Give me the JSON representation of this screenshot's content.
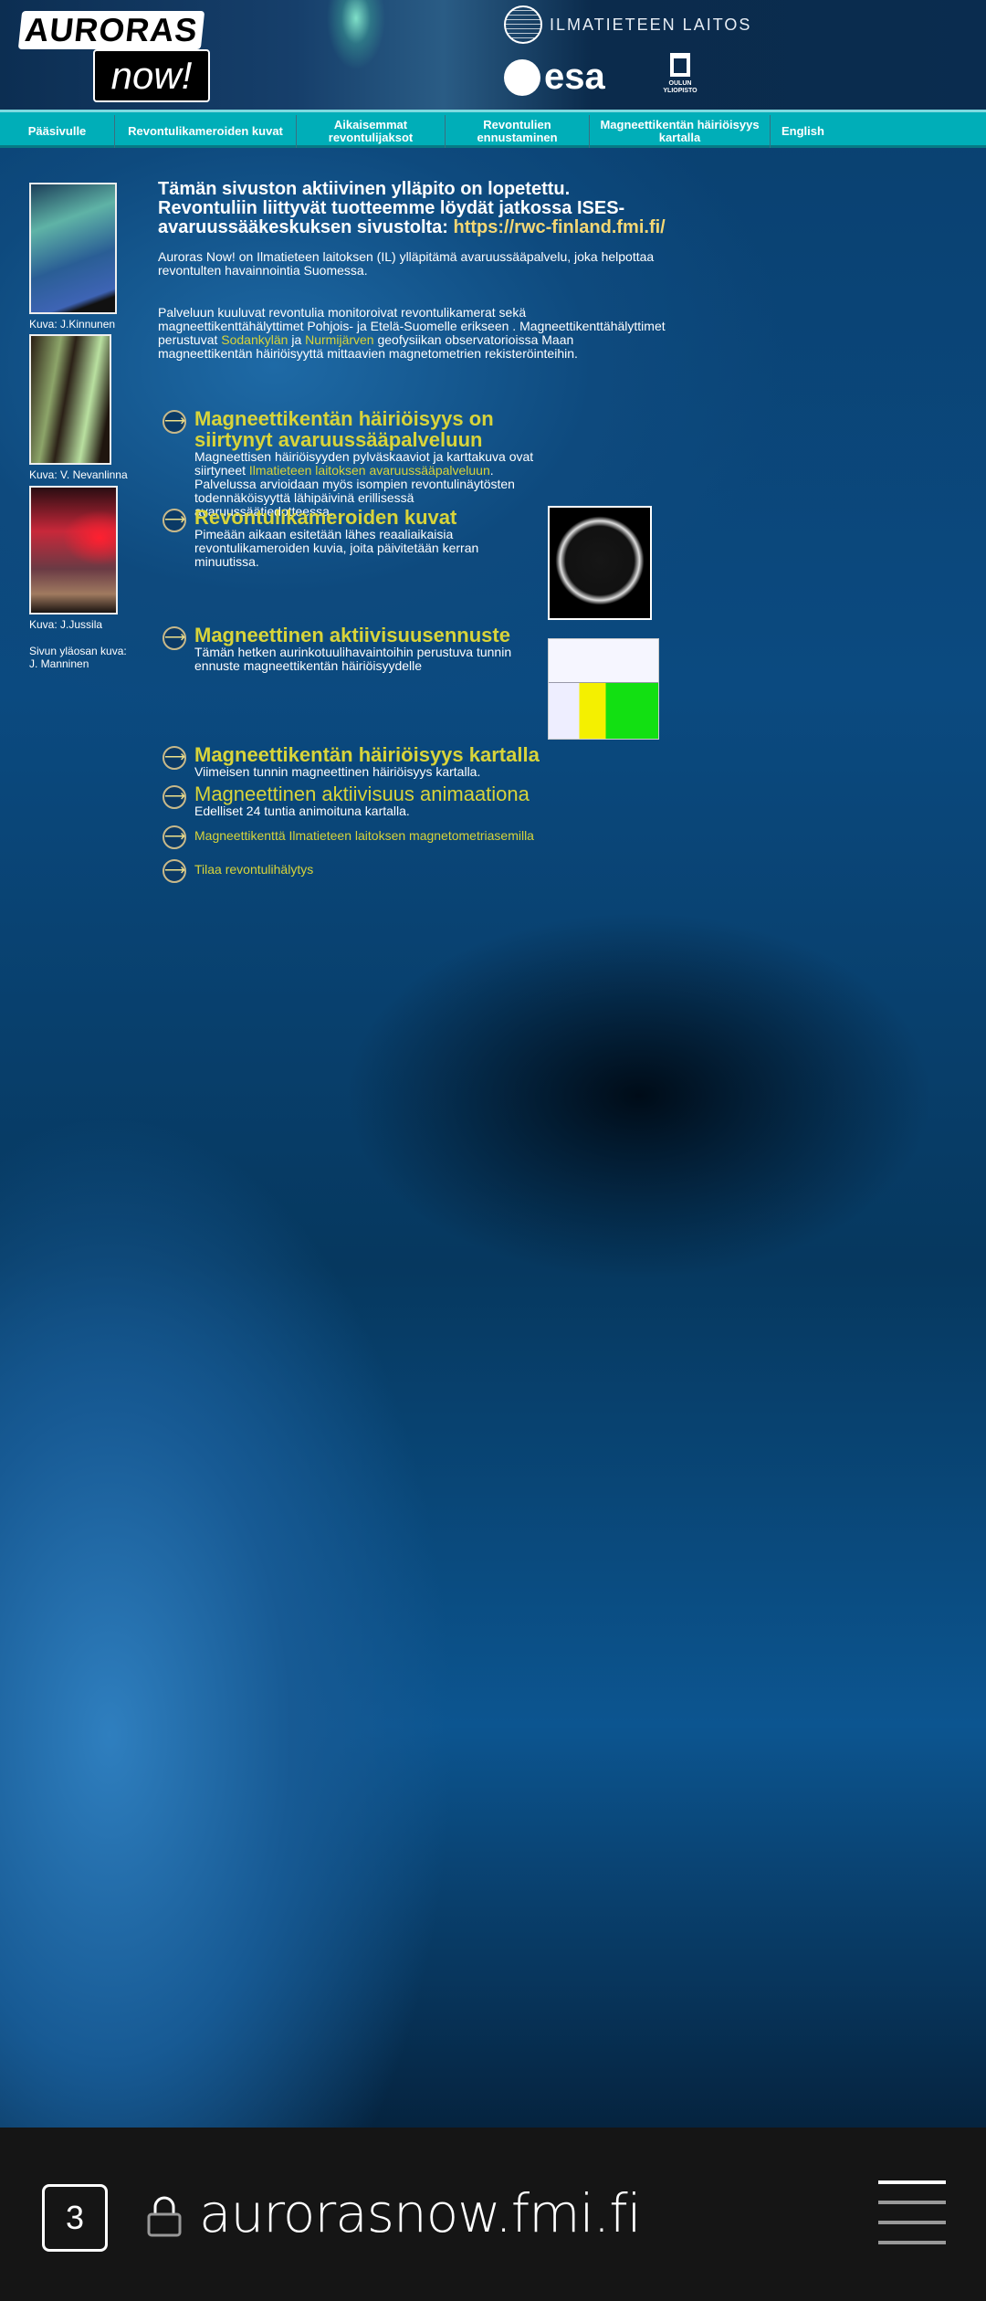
{
  "header": {
    "logo_top": "AURORAS",
    "logo_bottom": "now!",
    "partner_fmi": "ILMATIETEEN LAITOS",
    "partner_esa": "esa",
    "partner_oulu": "OULUN YLIOPISTO"
  },
  "nav": [
    {
      "label": "Pääsivulle"
    },
    {
      "label": "Revontulikameroiden kuvat"
    },
    {
      "label": "Aikaisemmat revontulijaksot"
    },
    {
      "label": "Revontulien ennustaminen"
    },
    {
      "label": "Magneettikentän häiriöisyys kartalla"
    },
    {
      "label": "English"
    }
  ],
  "sidebar": {
    "captions": [
      "Kuva: J.Kinnunen",
      "Kuva: V. Nevanlinna",
      "Kuva: J.Jussila"
    ],
    "credit_1": "Sivun yläosan kuva:",
    "credit_2": "J. Manninen"
  },
  "main": {
    "notice": "Tämän sivuston aktiivinen ylläpito on lopetettu. Revontuliin liittyvät tuotteemme löydät jatkossa ISES-avaruussääkeskuksen sivustolta: ",
    "notice_link": "https://rwc-finland.fmi.fi/",
    "intro": "Auroras Now! on Ilmatieteen laitoksen (IL) ylläpitämä avaruussääpalvelu, joka helpottaa revontulten havainnointia Suomessa.",
    "p2_a": "Palveluun kuuluvat revontulia monitoroivat revontulikamerat sekä magneettikenttähälyttimet Pohjois- ja Etelä-Suomelle erikseen . Magneettikenttähälyttimet perustuvat ",
    "p2_link1": "Sodankylän",
    "p2_b": " ja ",
    "p2_link2": "Nurmijärven",
    "p2_c": " geofysiikan observatorioissa Maan magneettikentän häiriöisyyttä mittaavien magnetometrien rekisteröinteihin.",
    "items": [
      {
        "title": "Magneettikentän häiriöisyys on siirtynyt avaruussääpalveluun",
        "text_a": "Magneettisen häiriöisyyden pylväskaaviot ja karttakuva ovat siirtyneet ",
        "link": "Ilmatieteen laitoksen avaruussääpalveluun",
        "text_b": ". Palvelussa arvioidaan myös isompien revontulinäytösten todennäköisyyttä lähipäivinä erillisessä avaruussäätiedotteessa."
      },
      {
        "title": "Revontulikameroiden kuvat",
        "text": "Pimeään aikaan esitetään lähes reaaliaikaisia revontulikameroiden kuvia, joita päivitetään kerran minuutissa."
      },
      {
        "title": "Magneettinen aktiivisuusennuste",
        "text": "Tämän hetken aurinkotuulihavaintoihin perustuva tunnin ennuste magneettikentän häiriöisyydelle"
      },
      {
        "title": "Magneettikentän häiriöisyys kartalla",
        "text": "Viimeisen tunnin magneettinen häiriöisyys kartalla."
      },
      {
        "title": "Magneettinen aktiivisuus animaationa",
        "text": "Edelliset 24 tuntia animoituna kartalla."
      },
      {
        "link": "Magneettikenttä Ilmatieteen laitoksen magnetometriasemilla"
      },
      {
        "link": "Tilaa revontulihälytys"
      }
    ]
  },
  "browser": {
    "tab_count": "3",
    "url": "aurorasnow.fmi.fi"
  },
  "colors": {
    "nav": "#00aeb8",
    "link": "#d8d43a",
    "notice_link": "#f4d774"
  }
}
